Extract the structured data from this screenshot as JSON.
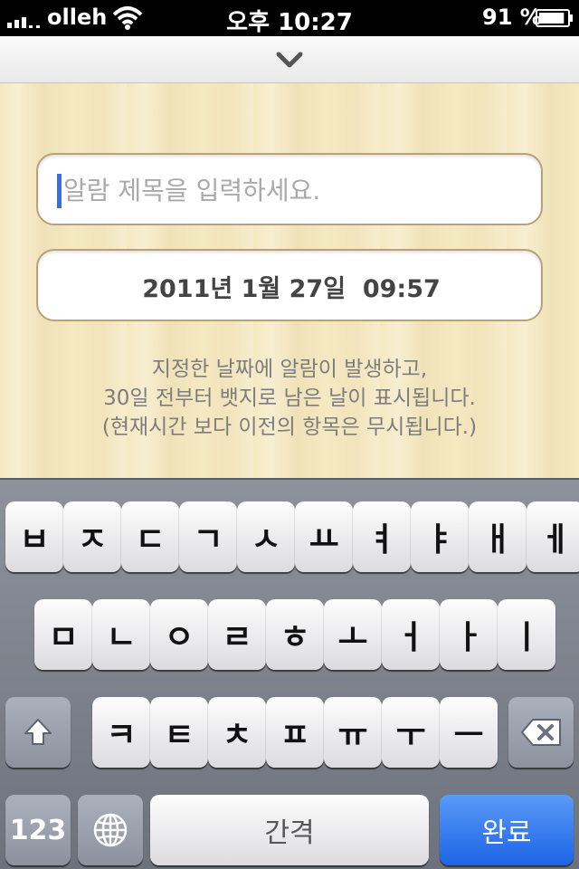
{
  "status_bar": {
    "carrier": "olleh",
    "time": "오후 10:27",
    "battery_percent": "91 %",
    "battery_level": 0.91
  },
  "form": {
    "title_placeholder": "알람 제목을 입력하세요.",
    "title_value": "",
    "date_value": "2011년 1월 27일  09:57"
  },
  "hint": {
    "line1": "지정한 날짜에 알람이 발생하고,",
    "line2": "30일 전부터 뱃지로 남은 날이 표시됩니다.",
    "line3": "(현재시간 보다 이전의 항목은 무시됩니다.)"
  },
  "keyboard": {
    "row1": [
      "ㅂ",
      "ㅈ",
      "ㄷ",
      "ㄱ",
      "ㅅ",
      "ㅛ",
      "ㅕ",
      "ㅑ",
      "ㅐ",
      "ㅔ"
    ],
    "row2": [
      "ㅁ",
      "ㄴ",
      "ㅇ",
      "ㄹ",
      "ㅎ",
      "ㅗ",
      "ㅓ",
      "ㅏ",
      "ㅣ"
    ],
    "row3": [
      "ㅋ",
      "ㅌ",
      "ㅊ",
      "ㅍ",
      "ㅠ",
      "ㅜ",
      "ㅡ"
    ],
    "numbers_label": "123",
    "space_label": "간격",
    "done_label": "완료",
    "icons": [
      "shift-icon",
      "globe-icon",
      "backspace-icon"
    ]
  },
  "colors": {
    "accent_blue": "#1b64e6",
    "wood": "#f5e9c2",
    "field_border": "#b8a27a"
  }
}
